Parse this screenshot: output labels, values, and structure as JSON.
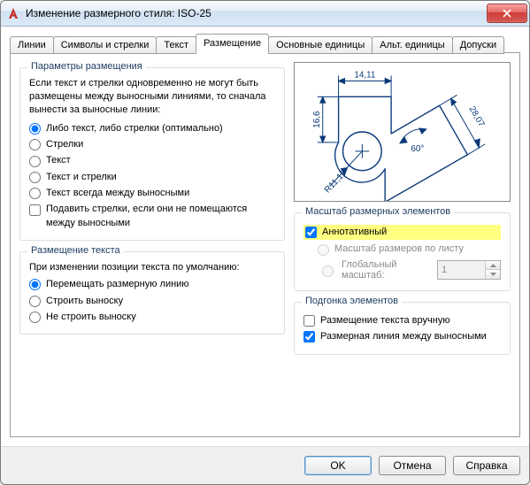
{
  "title": "Изменение размерного стиля: ISO-25",
  "tabs": [
    {
      "label": "Линии"
    },
    {
      "label": "Символы и стрелки"
    },
    {
      "label": "Текст"
    },
    {
      "label": "Размещение"
    },
    {
      "label": "Основные единицы"
    },
    {
      "label": "Альт. единицы"
    },
    {
      "label": "Допуски"
    }
  ],
  "fit_options": {
    "title": "Параметры размещения",
    "intro": "Если текст и стрелки одновременно не могут быть размещены между выносными линиями, то сначала вынести за выносные линии:",
    "opts": [
      "Либо текст, либо стрелки (оптимально)",
      "Стрелки",
      "Текст",
      "Текст и стрелки",
      "Текст всегда между выносными"
    ],
    "suppress": "Подавить стрелки, если они не помещаются между выносными"
  },
  "text_placement": {
    "title": "Размещение текста",
    "intro": "При изменении позиции текста по умолчанию:",
    "opts": [
      "Перемещать размерную линию",
      "Строить выноску",
      "Не строить выноску"
    ]
  },
  "scale": {
    "title": "Масштаб размерных элементов",
    "annotative": "Аннотативный",
    "layout": "Масштаб размеров по листу",
    "overall_label": "Глобальный масштаб:",
    "overall_value": "1"
  },
  "fine": {
    "title": "Подгонка элементов",
    "manual": "Размещение текста вручную",
    "dimline": "Размерная линия между выносными"
  },
  "preview": {
    "dim_top": "14,11",
    "dim_left": "16,6",
    "dim_diag": "28,07",
    "dim_angle": "60°",
    "dim_radius": "R11,17"
  },
  "buttons": {
    "ok": "OK",
    "cancel": "Отмена",
    "help": "Справка"
  }
}
